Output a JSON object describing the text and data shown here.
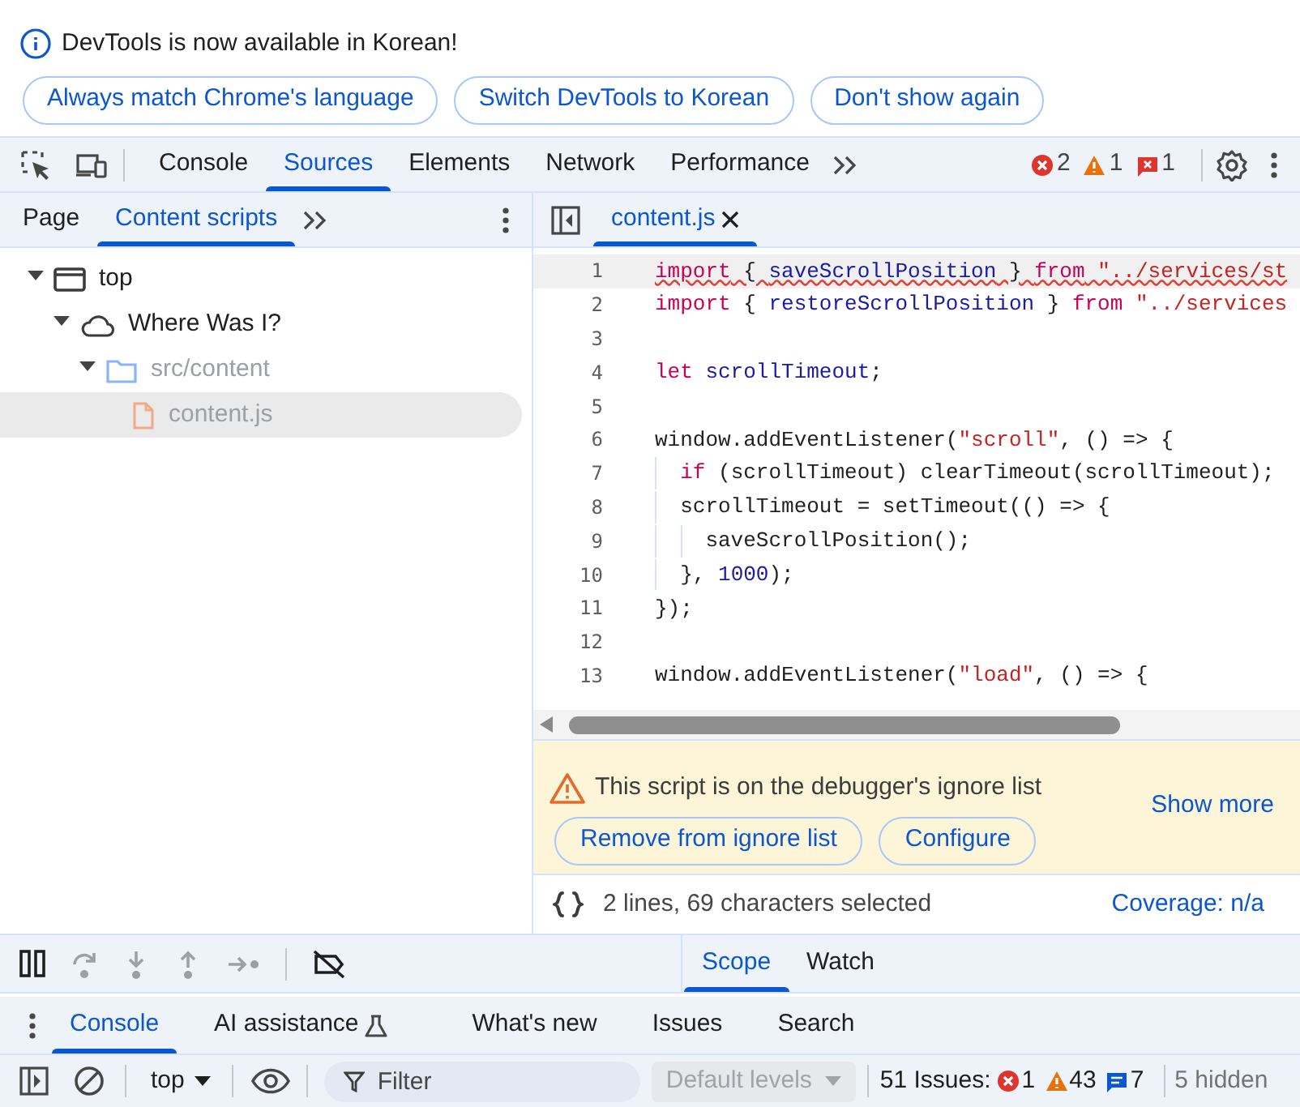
{
  "infobar": {
    "message": "DevTools is now available in Korean!",
    "buttons": [
      "Always match Chrome's language",
      "Switch DevTools to Korean",
      "Don't show again"
    ]
  },
  "main_tabs": [
    {
      "label": "Console",
      "selected": false
    },
    {
      "label": "Sources",
      "selected": true
    },
    {
      "label": "Elements",
      "selected": false
    },
    {
      "label": "Network",
      "selected": false
    },
    {
      "label": "Performance",
      "selected": false
    }
  ],
  "counters": [
    {
      "kind": "error",
      "count": "2"
    },
    {
      "kind": "warning",
      "count": "1"
    },
    {
      "kind": "issue",
      "count": "1"
    }
  ],
  "navigator": {
    "tabs": [
      {
        "label": "Page",
        "selected": false
      },
      {
        "label": "Content scripts",
        "selected": true
      }
    ],
    "tree": [
      {
        "kind": "frame",
        "label": "top",
        "expanded": true,
        "ignored": false,
        "selected": false,
        "children": [
          {
            "kind": "extension",
            "label": "Where Was I?",
            "expanded": true,
            "ignored": false,
            "selected": false,
            "children": [
              {
                "kind": "folder",
                "label": "src/content",
                "expanded": true,
                "ignored": true,
                "selected": false,
                "children": [
                  {
                    "kind": "file",
                    "label": "content.js",
                    "ignored": true,
                    "selected": true
                  }
                ]
              }
            ]
          }
        ]
      }
    ]
  },
  "editor": {
    "tabs": [
      {
        "label": "content.js",
        "selected": true
      }
    ],
    "lines": [
      {
        "number": "1",
        "error": true,
        "tokens": [
          {
            "kind": "keyword",
            "text": "import"
          },
          {
            "kind": "plain",
            "text": " { "
          },
          {
            "kind": "def",
            "text": "saveScrollPosition"
          },
          {
            "kind": "plain",
            "text": " } "
          },
          {
            "kind": "keyword",
            "text": "from"
          },
          {
            "kind": "string",
            "text": " \"../services/st"
          }
        ]
      },
      {
        "number": "2",
        "error": false,
        "tokens": [
          {
            "kind": "keyword",
            "text": "import"
          },
          {
            "kind": "plain",
            "text": " { "
          },
          {
            "kind": "def",
            "text": "restoreScrollPosition"
          },
          {
            "kind": "plain",
            "text": " } "
          },
          {
            "kind": "keyword",
            "text": "from"
          },
          {
            "kind": "string",
            "text": " \"../services"
          }
        ]
      },
      {
        "number": "3"
      },
      {
        "number": "4",
        "error": false,
        "tokens": [
          {
            "kind": "keyword",
            "text": "let"
          },
          {
            "kind": "def",
            "text": " scrollTimeout"
          },
          {
            "kind": "plain",
            "text": ";"
          }
        ]
      },
      {
        "number": "5"
      },
      {
        "number": "6",
        "error": false,
        "tokens": [
          {
            "kind": "plain",
            "text": "window.addEventListener("
          },
          {
            "kind": "string",
            "text": "\"scroll\""
          },
          {
            "kind": "plain",
            "text": ", () => {"
          }
        ]
      },
      {
        "number": "7",
        "error": false,
        "tokens": [
          {
            "kind": "keyword",
            "text": "  if"
          },
          {
            "kind": "plain",
            "text": " (scrollTimeout) clearTimeout(scrollTimeout);"
          }
        ]
      },
      {
        "number": "8",
        "error": false,
        "tokens": [
          {
            "kind": "plain",
            "text": "  scrollTimeout = setTimeout(() => {"
          }
        ]
      },
      {
        "number": "9",
        "error": false,
        "tokens": [
          {
            "kind": "plain",
            "text": "    saveScrollPosition();"
          }
        ]
      },
      {
        "number": "10",
        "error": false,
        "tokens": [
          {
            "kind": "plain",
            "text": "  }, "
          },
          {
            "kind": "number",
            "text": "1000"
          },
          {
            "kind": "plain",
            "text": ");"
          }
        ]
      },
      {
        "number": "11",
        "error": false,
        "tokens": [
          {
            "kind": "plain",
            "text": "});"
          }
        ]
      },
      {
        "number": "12"
      },
      {
        "number": "13",
        "error": false,
        "tokens": [
          {
            "kind": "plain",
            "text": "window.addEventListener("
          },
          {
            "kind": "string",
            "text": "\"load\""
          },
          {
            "kind": "plain",
            "text": ", () => {"
          }
        ]
      }
    ],
    "ignore_bar": {
      "message": "This script is on the debugger's ignore list",
      "buttons": [
        "Remove from ignore list",
        "Configure"
      ],
      "link": "Show more"
    },
    "status": {
      "selection": "2 lines, 69 characters selected",
      "coverage": "Coverage: n/a"
    }
  },
  "debugger": {
    "tabs": [
      {
        "label": "Scope",
        "selected": true
      },
      {
        "label": "Watch",
        "selected": false
      }
    ]
  },
  "drawer": {
    "tabs": [
      {
        "label": "Console",
        "selected": true,
        "kind": "plain"
      },
      {
        "label": "AI assistance",
        "selected": false,
        "kind": "experimental"
      },
      {
        "label": "What's new",
        "selected": false,
        "kind": "plain"
      },
      {
        "label": "Issues",
        "selected": false,
        "kind": "plain"
      },
      {
        "label": "Search",
        "selected": false,
        "kind": "plain"
      }
    ]
  },
  "console_toolbar": {
    "context": "top",
    "filter_placeholder": "Filter",
    "levels": "Default levels",
    "levels_disabled": true,
    "issues_label": "51 Issues:",
    "issue_counts": [
      {
        "kind": "error",
        "count": "1"
      },
      {
        "kind": "warning",
        "count": "43"
      },
      {
        "kind": "info",
        "count": "7"
      }
    ],
    "hidden": "5 hidden"
  }
}
